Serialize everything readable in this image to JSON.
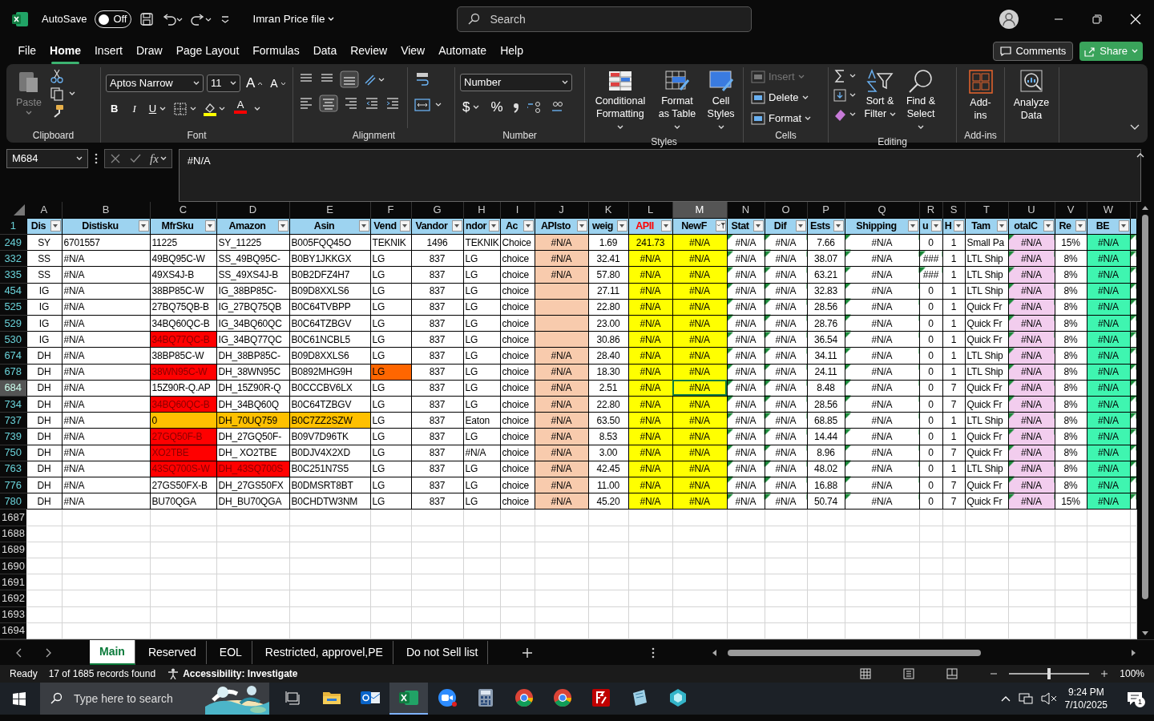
{
  "title_bar": {
    "autosave_label": "AutoSave",
    "autosave": {
      "on": false,
      "text": "Off"
    },
    "document_title": "Imran Price file",
    "search_placeholder": "Search"
  },
  "menu": {
    "tabs": [
      {
        "label": "File",
        "selected": false
      },
      {
        "label": "Home",
        "selected": true
      },
      {
        "label": "Insert",
        "selected": false
      },
      {
        "label": "Draw",
        "selected": false
      },
      {
        "label": "Page Layout",
        "selected": false
      },
      {
        "label": "Formulas",
        "selected": false
      },
      {
        "label": "Data",
        "selected": false
      },
      {
        "label": "Review",
        "selected": false
      },
      {
        "label": "View",
        "selected": false
      },
      {
        "label": "Automate",
        "selected": false
      },
      {
        "label": "Help",
        "selected": false
      }
    ],
    "comments": "Comments",
    "share": "Share"
  },
  "ribbon": {
    "groups": [
      {
        "kind": "clipboard",
        "label": "Clipboard",
        "paste": {
          "label": "Paste",
          "disabled": true
        }
      },
      {
        "kind": "font",
        "label": "Font",
        "font_name": "Aptos Narrow",
        "font_size": "11",
        "grow": "A",
        "shrink": "A",
        "bold": "B",
        "italic": "I",
        "underline": "U",
        "font_color": "A"
      },
      {
        "kind": "alignment",
        "label": "Alignment"
      },
      {
        "kind": "number",
        "label": "Number",
        "format": "Number",
        "currency": "$",
        "percent": "%"
      },
      {
        "kind": "styles",
        "label": "Styles",
        "buttons": [
          "Conditional Formatting",
          "Format as Table",
          "Cell Styles"
        ]
      },
      {
        "kind": "cells",
        "label": "Cells",
        "buttons": [
          {
            "label": "Insert",
            "disabled": true
          },
          {
            "label": "Delete",
            "disabled": false
          },
          {
            "label": "Format",
            "disabled": false
          }
        ]
      },
      {
        "kind": "editing",
        "label": "Editing",
        "buttons": [
          "Sort & Filter",
          "Find & Select"
        ]
      },
      {
        "kind": "addins",
        "label": "Add-ins",
        "buttons": [
          "Add-ins"
        ]
      },
      {
        "kind": "analyze",
        "buttons": [
          "Analyze Data"
        ]
      }
    ]
  },
  "formula_bar": {
    "name_box": "M684",
    "fx": "fx",
    "formula": "#N/A"
  },
  "sheet": {
    "header_row_number": "1",
    "columns": [
      {
        "letter": "A",
        "header": "Dis",
        "selected": false,
        "filtered": false,
        "header_alert": false
      },
      {
        "letter": "B",
        "header": "Distisku",
        "selected": false,
        "filtered": false,
        "header_alert": false
      },
      {
        "letter": "C",
        "header": "MfrSku",
        "selected": false,
        "filtered": false,
        "header_alert": false
      },
      {
        "letter": "D",
        "header": "Amazon",
        "selected": false,
        "filtered": false,
        "header_alert": false
      },
      {
        "letter": "E",
        "header": "Asin",
        "selected": false,
        "filtered": false,
        "header_alert": false
      },
      {
        "letter": "F",
        "header": "Vend",
        "selected": false,
        "filtered": false,
        "header_alert": false
      },
      {
        "letter": "G",
        "header": "Vandor",
        "selected": false,
        "filtered": false,
        "header_alert": false
      },
      {
        "letter": "H",
        "header": "ndor",
        "selected": false,
        "filtered": false,
        "header_alert": false
      },
      {
        "letter": "I",
        "header": "Ac",
        "selected": false,
        "filtered": false,
        "header_alert": false
      },
      {
        "letter": "J",
        "header": "APIsto",
        "selected": false,
        "filtered": false,
        "header_alert": false,
        "color": "#f8cbad"
      },
      {
        "letter": "K",
        "header": "weig",
        "selected": false,
        "filtered": false,
        "header_alert": false
      },
      {
        "letter": "L",
        "header": "APII",
        "selected": false,
        "filtered": false,
        "header_alert": true,
        "color": "#ffff00"
      },
      {
        "letter": "M",
        "header": "NewF",
        "selected": true,
        "filtered": true,
        "header_alert": false,
        "color": "#ffff00"
      },
      {
        "letter": "N",
        "header": "Stat",
        "selected": false,
        "filtered": false,
        "header_alert": false,
        "flagged": true
      },
      {
        "letter": "O",
        "header": "Dif",
        "selected": false,
        "filtered": false,
        "header_alert": false,
        "flagged": true
      },
      {
        "letter": "P",
        "header": "Ests",
        "selected": false,
        "filtered": false,
        "header_alert": false
      },
      {
        "letter": "Q",
        "header": "Shipping",
        "selected": false,
        "filtered": false,
        "header_alert": false,
        "flagged": true
      },
      {
        "letter": "R",
        "header": "u",
        "selected": false,
        "filtered": false,
        "header_alert": false
      },
      {
        "letter": "S",
        "header": "H",
        "selected": false,
        "filtered": false,
        "header_alert": false
      },
      {
        "letter": "T",
        "header": "Tam",
        "selected": false,
        "filtered": false,
        "header_alert": false
      },
      {
        "letter": "U",
        "header": "otalC",
        "selected": false,
        "filtered": false,
        "header_alert": false,
        "color": "#f2cdee",
        "flagged": true
      },
      {
        "letter": "V",
        "header": "Re",
        "selected": false,
        "filtered": false,
        "header_alert": false
      },
      {
        "letter": "W",
        "header": "BE",
        "selected": false,
        "filtered": false,
        "header_alert": false,
        "color": "#3ff5b0"
      },
      {
        "selected": false,
        "flagged": true
      }
    ],
    "rows": [
      {
        "number": "249",
        "selected": false,
        "cells": [
          "SY",
          "6701557",
          "11225",
          "SY_11225",
          "B005FQQ45O",
          "TEKNIK",
          "1496",
          "TEKNIK",
          "Choice",
          "#N/A",
          "1.69",
          "241.73",
          "#N/A",
          "#N/A",
          "#N/A",
          "7.66",
          "#N/A",
          "0",
          "1",
          "Small Pa",
          "#N/A",
          "15%",
          "#N/A",
          ""
        ]
      },
      {
        "number": "332",
        "selected": false,
        "cells": [
          "SS",
          "#N/A",
          "49BQ95C-W",
          "SS_49BQ95C-",
          "B0BY1JKKGX",
          "LG",
          "837",
          "LG",
          "choice",
          "#N/A",
          "32.41",
          "#N/A",
          "#N/A",
          "#N/A",
          "#N/A",
          "38.07",
          "#N/A",
          {
            "text": "###",
            "flagged": true
          },
          "1",
          "LTL Ship",
          "#N/A",
          "8%",
          "#N/A",
          ""
        ]
      },
      {
        "number": "335",
        "selected": false,
        "cells": [
          "SS",
          "#N/A",
          "49XS4J-B",
          "SS_49XS4J-B",
          "B0B2DFZ4H7",
          "LG",
          "837",
          "LG",
          "choice",
          "#N/A",
          "57.80",
          "#N/A",
          "#N/A",
          "#N/A",
          "#N/A",
          "63.21",
          "#N/A",
          {
            "text": "###",
            "flagged": true
          },
          "1",
          "LTL Ship",
          "#N/A",
          "8%",
          "#N/A",
          ""
        ]
      },
      {
        "number": "454",
        "selected": false,
        "cells": [
          "IG",
          "#N/A",
          "38BP85C-W",
          "IG_38BP85C-",
          "B09D8XXLS6",
          "LG",
          "837",
          "LG",
          "choice",
          "",
          "27.11",
          "#N/A",
          "#N/A",
          "#N/A",
          "#N/A",
          "32.83",
          "#N/A",
          "0",
          "1",
          "LTL Ship",
          "#N/A",
          "8%",
          "#N/A",
          ""
        ]
      },
      {
        "number": "525",
        "selected": false,
        "cells": [
          "IG",
          "#N/A",
          "27BQ75QB-B",
          "IG_27BQ75QB",
          "B0C64TVBPP",
          "LG",
          "837",
          "LG",
          "choice",
          "",
          "22.80",
          "#N/A",
          "#N/A",
          "#N/A",
          "#N/A",
          "28.56",
          "#N/A",
          "0",
          "1",
          "Quick Fr",
          "#N/A",
          "8%",
          "#N/A",
          ""
        ]
      },
      {
        "number": "529",
        "selected": false,
        "cells": [
          "IG",
          "#N/A",
          "34BQ60QC-B",
          "IG_34BQ60QC",
          "B0C64TZBGV",
          "LG",
          "837",
          "LG",
          "choice",
          "",
          "23.00",
          "#N/A",
          "#N/A",
          "#N/A",
          "#N/A",
          "28.76",
          "#N/A",
          "0",
          "1",
          "Quick Fr",
          "#N/A",
          "8%",
          "#N/A",
          ""
        ]
      },
      {
        "number": "530",
        "selected": false,
        "cells": [
          "IG",
          "#N/A",
          {
            "text": "34BQ77QC-B",
            "color": "#ff0000"
          },
          "IG_34BQ77QC",
          "B0C61NCBL5",
          "LG",
          "837",
          "LG",
          "choice",
          "",
          "30.86",
          "#N/A",
          "#N/A",
          "#N/A",
          "#N/A",
          "36.54",
          "#N/A",
          "0",
          "1",
          "Quick Fr",
          "#N/A",
          "8%",
          "#N/A",
          ""
        ]
      },
      {
        "number": "674",
        "selected": false,
        "cells": [
          "DH",
          "#N/A",
          "38BP85C-W",
          "DH_38BP85C-",
          "B09D8XXLS6",
          "LG",
          "837",
          "LG",
          "choice",
          "#N/A",
          "28.40",
          "#N/A",
          "#N/A",
          "#N/A",
          "#N/A",
          "34.11",
          "#N/A",
          "0",
          "1",
          "LTL Ship",
          "#N/A",
          "8%",
          "#N/A",
          ""
        ]
      },
      {
        "number": "678",
        "selected": false,
        "cells": [
          "DH",
          "#N/A",
          {
            "text": "38WN95C-W",
            "color": "#ff0000"
          },
          "DH_38WN95C",
          "B0892MHG9H",
          {
            "text": "LG",
            "color": "#ff6600"
          },
          "837",
          "LG",
          "choice",
          "#N/A",
          "18.30",
          "#N/A",
          "#N/A",
          "#N/A",
          "#N/A",
          "24.11",
          "#N/A",
          "0",
          "1",
          "LTL Ship",
          "#N/A",
          "8%",
          "#N/A",
          ""
        ]
      },
      {
        "number": "684",
        "selected": true,
        "cells": [
          "DH",
          "#N/A",
          "15Z90R-Q.AP",
          "DH_15Z90R-Q",
          "B0CCCBV6LX",
          "LG",
          "837",
          "LG",
          "choice",
          "#N/A",
          "2.51",
          "#N/A",
          "#N/A",
          "#N/A",
          "#N/A",
          "8.48",
          "#N/A",
          "0",
          "7",
          "Quick Fr",
          "#N/A",
          "8%",
          "#N/A",
          ""
        ]
      },
      {
        "number": "734",
        "selected": false,
        "cells": [
          "DH",
          "#N/A",
          {
            "text": "34BQ60QC-B",
            "color": "#ff0000"
          },
          "DH_34BQ60Q",
          "B0C64TZBGV",
          "LG",
          "837",
          "LG",
          "choice",
          "#N/A",
          "22.80",
          "#N/A",
          "#N/A",
          "#N/A",
          "#N/A",
          "28.56",
          "#N/A",
          "0",
          "7",
          "Quick Fr",
          "#N/A",
          "8%",
          "#N/A",
          ""
        ]
      },
      {
        "number": "737",
        "selected": false,
        "cells": [
          "DH",
          "#N/A",
          {
            "text": "0",
            "color": "#ffc000"
          },
          {
            "text": "DH_70UQ759",
            "color": "#ffc000"
          },
          {
            "text": "B0C7ZZ2SZW",
            "color": "#ffc000"
          },
          "LG",
          "837",
          "Eaton",
          "choice",
          "#N/A",
          "63.50",
          "#N/A",
          "#N/A",
          "#N/A",
          "#N/A",
          "68.85",
          "#N/A",
          "0",
          "1",
          "LTL Ship",
          "#N/A",
          "8%",
          "#N/A",
          ""
        ]
      },
      {
        "number": "739",
        "selected": false,
        "cells": [
          "DH",
          "#N/A",
          {
            "text": "27GQ50F-B",
            "color": "#ff0000"
          },
          "DH_27GQ50F-",
          "B09V7D96TK",
          "LG",
          "837",
          "LG",
          "choice",
          "#N/A",
          "8.53",
          "#N/A",
          "#N/A",
          "#N/A",
          "#N/A",
          "14.44",
          "#N/A",
          "0",
          "1",
          "Quick Fr",
          "#N/A",
          "8%",
          "#N/A",
          ""
        ]
      },
      {
        "number": "750",
        "selected": false,
        "cells": [
          "DH",
          "#N/A",
          {
            "text": "XO2TBE",
            "color": "#ff0000"
          },
          "DH_ XO2TBE",
          "B0DJV4X2XD",
          "LG",
          "837",
          "#N/A",
          "choice",
          "#N/A",
          "3.00",
          "#N/A",
          "#N/A",
          "#N/A",
          "#N/A",
          "8.96",
          "#N/A",
          "0",
          "7",
          "Quick Fr",
          "#N/A",
          "8%",
          "#N/A",
          ""
        ]
      },
      {
        "number": "763",
        "selected": false,
        "cells": [
          "DH",
          "#N/A",
          {
            "text": "43SQ700S-W",
            "color": "#ff0000"
          },
          {
            "text": "DH_43SQ700S",
            "color": "#ff0000"
          },
          "B0C251N7S5",
          "LG",
          "837",
          "LG",
          "choice",
          "#N/A",
          "42.45",
          "#N/A",
          "#N/A",
          "#N/A",
          "#N/A",
          "48.02",
          "#N/A",
          "0",
          "1",
          "LTL Ship",
          "#N/A",
          "8%",
          "#N/A",
          ""
        ]
      },
      {
        "number": "776",
        "selected": false,
        "cells": [
          "DH",
          "#N/A",
          "27GS50FX-B",
          "DH_27GS50FX",
          "B0DMSRT8BT",
          "LG",
          "837",
          "LG",
          "choice",
          "#N/A",
          "11.00",
          "#N/A",
          "#N/A",
          "#N/A",
          "#N/A",
          "16.88",
          "#N/A",
          "0",
          "7",
          "Quick Fr",
          "#N/A",
          "8%",
          "#N/A",
          ""
        ]
      },
      {
        "number": "780",
        "selected": false,
        "cells": [
          "DH",
          "#N/A",
          "BU70QGA",
          "DH_BU70QGA",
          "B0CHDTW3NM",
          "LG",
          "837",
          "LG",
          "choice",
          "#N/A",
          "45.20",
          "#N/A",
          "#N/A",
          "#N/A",
          "#N/A",
          "50.74",
          "#N/A",
          "0",
          "7",
          "Quick Fr",
          "#N/A",
          "15%",
          "#N/A",
          ""
        ]
      }
    ],
    "empty_rows": [
      "1687",
      "1688",
      "1689",
      "1690",
      "1691",
      "1692",
      "1693",
      "1694"
    ]
  },
  "sheet_tabs": [
    {
      "label": "Main",
      "selected": true
    },
    {
      "label": "Reserved",
      "selected": false
    },
    {
      "label": "EOL",
      "selected": false
    },
    {
      "label": "Restricted, approvel,PE",
      "selected": false
    },
    {
      "label": "Do not Sell list",
      "selected": false
    }
  ],
  "status_bar": {
    "ready": "Ready",
    "records": "17 of 1685 records found",
    "accessibility": "Accessibility: Investigate",
    "zoom": {
      "level": 0.5,
      "text": "100%"
    }
  },
  "taskbar": {
    "search_placeholder": "Type here to search",
    "apps": [
      {
        "kind": "taskview",
        "selected": false
      },
      {
        "kind": "explorer",
        "selected": false
      },
      {
        "kind": "outlook",
        "selected": false
      },
      {
        "kind": "excel",
        "selected": true
      },
      {
        "kind": "zoom",
        "selected": false
      },
      {
        "kind": "calculator",
        "selected": false
      },
      {
        "kind": "chrome",
        "selected": false
      },
      {
        "kind": "chrome",
        "selected": false
      },
      {
        "kind": "filezilla",
        "selected": false
      },
      {
        "kind": "notes",
        "selected": false
      },
      {
        "kind": "gem",
        "selected": false
      }
    ],
    "time": "9:24 PM",
    "date": "7/10/2025",
    "notifications": "1"
  }
}
